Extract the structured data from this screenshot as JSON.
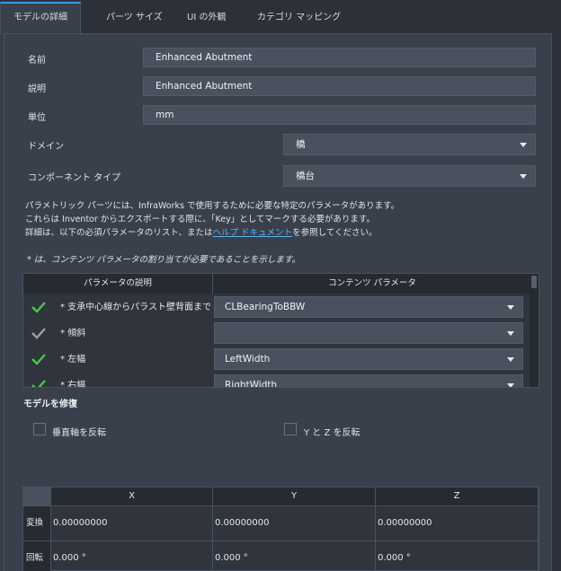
{
  "tabs": [
    {
      "label": "モデルの詳細"
    },
    {
      "label": "パーツ サイズ"
    },
    {
      "label": "UI の外観"
    },
    {
      "label": "カテゴリ マッピング"
    }
  ],
  "form": {
    "name_label": "名前",
    "name_value": "Enhanced Abutment",
    "desc_label": "説明",
    "desc_value": "Enhanced Abutment",
    "unit_label": "単位",
    "unit_value": "mm",
    "domain_label": "ドメイン",
    "domain_value": "橋",
    "component_label": "コンポーネント タイプ",
    "component_value": "橋台"
  },
  "info": {
    "line1": "パラメトリック パーツには、InfraWorks で使用するために必要な特定のパラメータがあります。",
    "line2": "これらは Inventor からエクスポートする際に、「Key」としてマークする必要があります。",
    "line3_pre": "詳細は、以下の必須パラメータのリスト、または",
    "line3_link": "ヘルプ ドキュメント",
    "line3_post": "を参照してください。",
    "required_note": "* は、コンテンツ パラメータの割り当てが必要であることを示します。"
  },
  "params_table": {
    "col_desc": "パラメータの説明",
    "col_content": "コンテンツ パラメータ",
    "rows": [
      {
        "desc": "* 支承中心線からパラスト壁背面まで",
        "value": "CLBearingToBBW",
        "status": "green"
      },
      {
        "desc": "* 傾斜",
        "value": "",
        "status": "gray"
      },
      {
        "desc": "* 左幅",
        "value": "LeftWidth",
        "status": "green"
      },
      {
        "desc": "* 右幅",
        "value": "RightWidth",
        "status": "green"
      }
    ]
  },
  "modify": {
    "title": "モデルを修復",
    "flip_vertical": "垂直軸を反転",
    "flip_yz": "Y と Z を反転"
  },
  "transform": {
    "cols": [
      "X",
      "Y",
      "Z"
    ],
    "rows": [
      {
        "label": "変換",
        "values": [
          "0.00000000",
          "0.00000000",
          "0.00000000"
        ]
      },
      {
        "label": "回転",
        "values": [
          "0.000 °",
          "0.000 °",
          "0.000 °"
        ]
      }
    ]
  },
  "colors": {
    "accent": "#3a9ae0",
    "check_green": "#4cc64c",
    "check_gray": "#9aa0aa"
  }
}
